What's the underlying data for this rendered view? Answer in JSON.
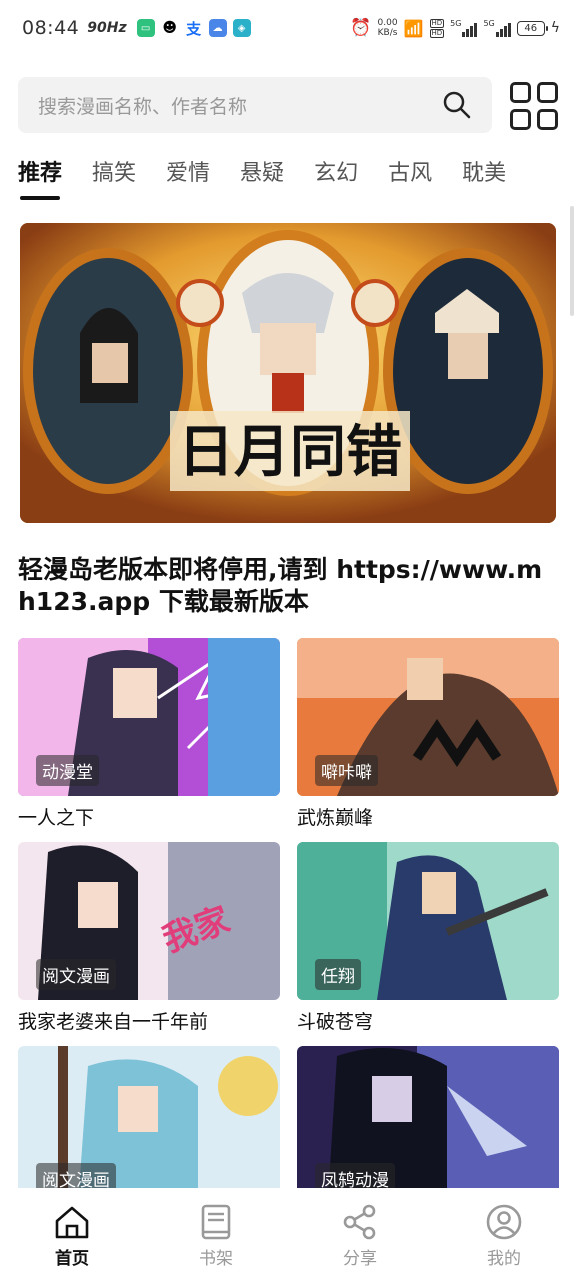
{
  "status": {
    "time": "08:44",
    "refresh": "90Hz",
    "net_speed_top": "0.00",
    "net_speed_bottom": "KB/s",
    "battery": "46",
    "sig1": "5G",
    "sig2": "5G"
  },
  "search": {
    "placeholder": "搜索漫画名称、作者名称"
  },
  "tabs": [
    "推荐",
    "搞笑",
    "爱情",
    "悬疑",
    "玄幻",
    "古风",
    "耽美"
  ],
  "banner": {
    "title": "日月同错"
  },
  "notice": "轻漫岛老版本即将停用,请到 https://www.mh123.app 下载最新版本",
  "comics": [
    {
      "title": "一人之下",
      "publisher": "动漫堂"
    },
    {
      "title": "武炼巅峰",
      "publisher": "噼咔噼"
    },
    {
      "title": "我家老婆来自一千年前",
      "publisher": "阅文漫画"
    },
    {
      "title": "斗破苍穹",
      "publisher": "任翔"
    },
    {
      "title": "",
      "publisher": "阅文漫画"
    },
    {
      "title": "",
      "publisher": "凤鸫动漫"
    }
  ],
  "nav": [
    {
      "label": "首页",
      "icon": "home-icon"
    },
    {
      "label": "书架",
      "icon": "bookshelf-icon"
    },
    {
      "label": "分享",
      "icon": "share-icon"
    },
    {
      "label": "我的",
      "icon": "profile-icon"
    }
  ],
  "colors": {
    "accent": "#111111",
    "muted": "#999999",
    "search_bg": "#f2f2f2"
  }
}
